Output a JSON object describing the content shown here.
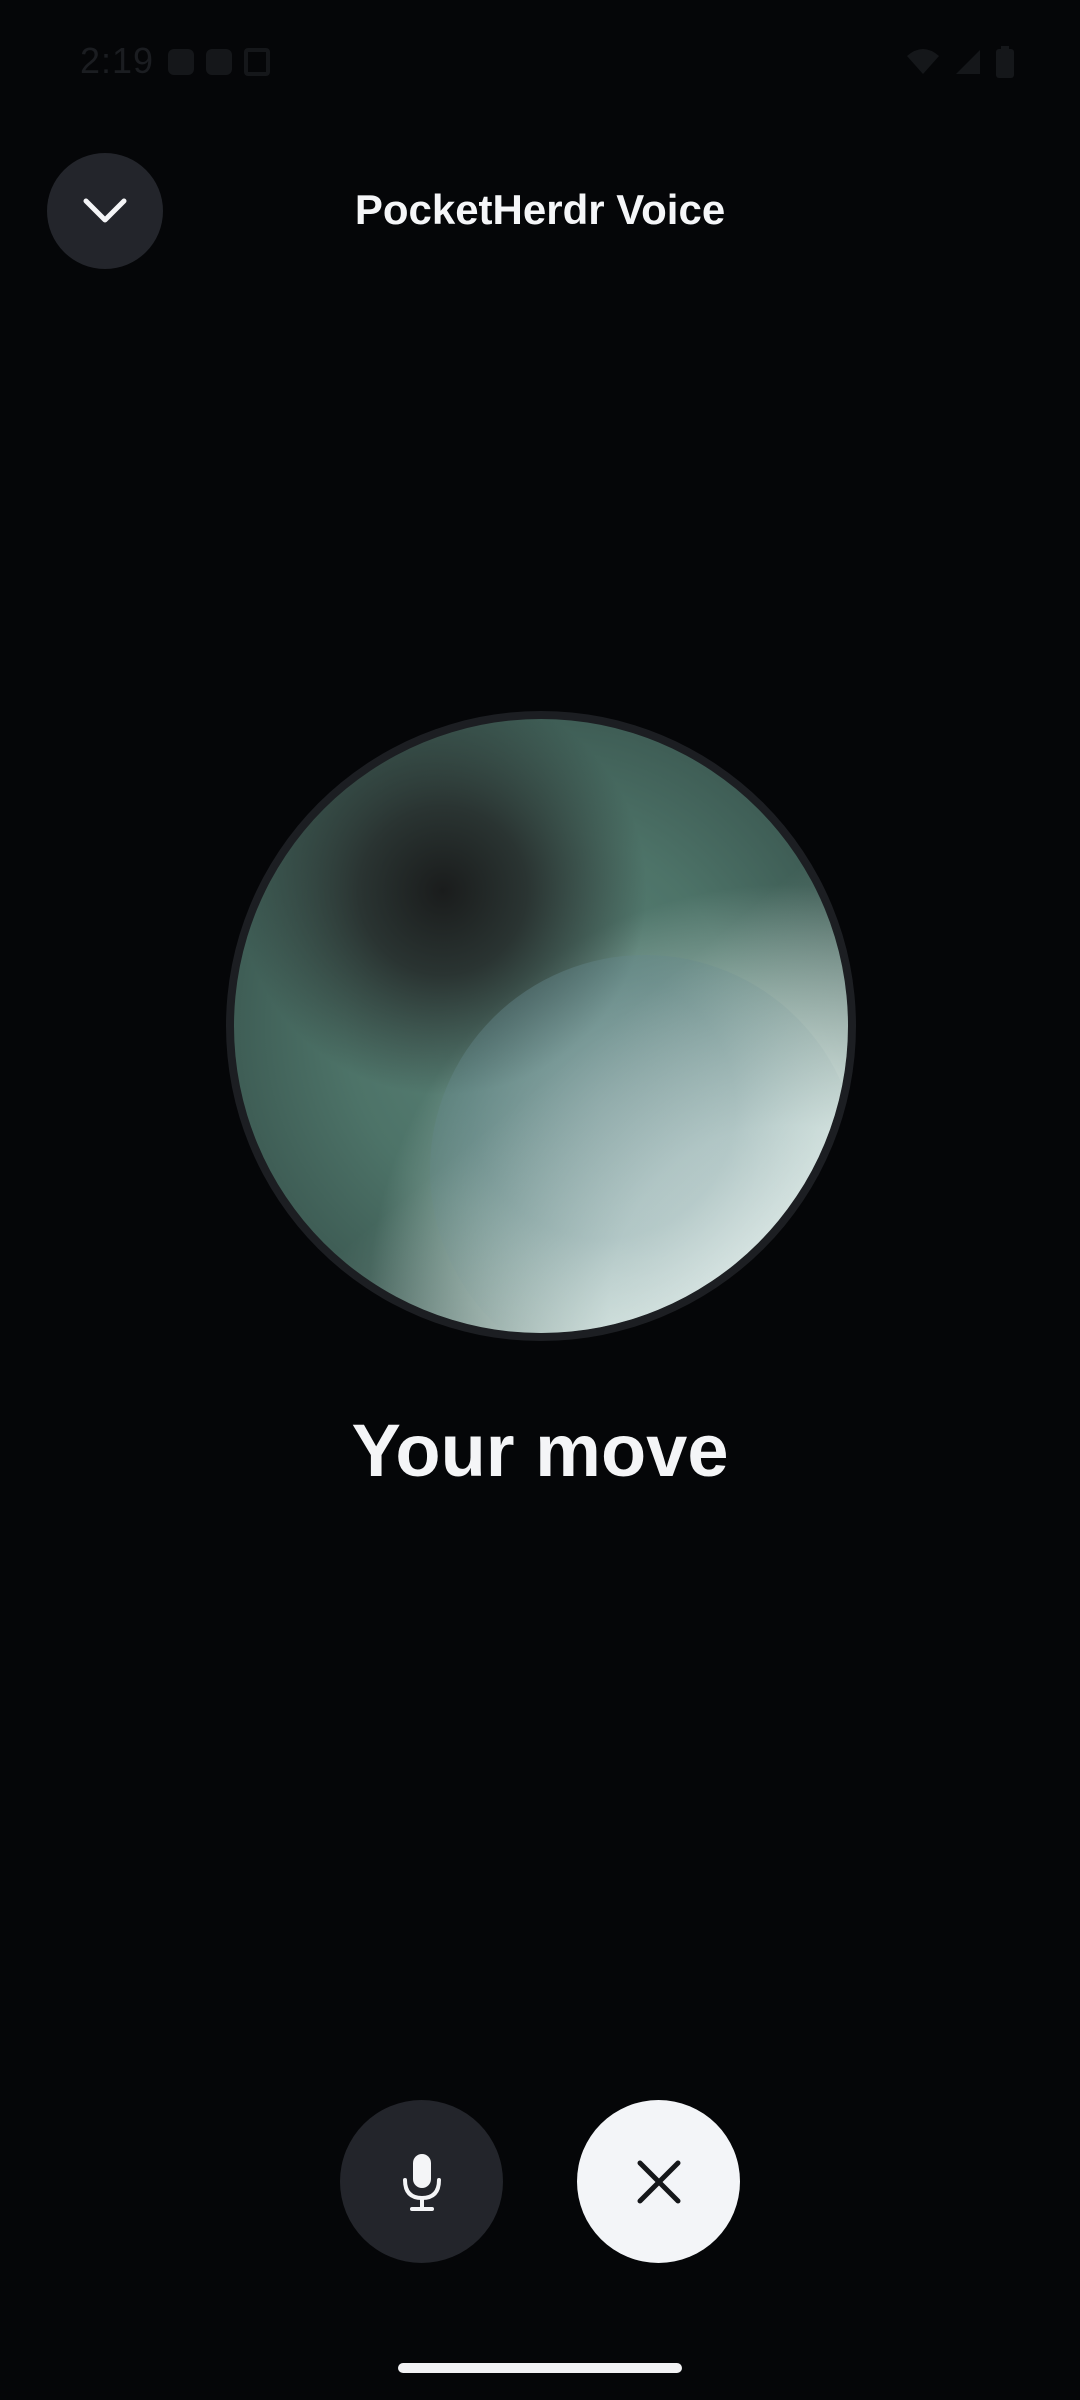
{
  "status_bar": {
    "time": "2:19",
    "icons": [
      "notification-icon",
      "screenshot-icon",
      "wifi-icon",
      "signal-icon",
      "battery-icon"
    ]
  },
  "header": {
    "title": "PocketHerdr Voice",
    "collapse_icon": "chevron-down-icon"
  },
  "orb": {
    "colors": {
      "base": "#4d7368",
      "dark": "#1a1c1c",
      "highlight": "#e8f1ee",
      "inner": "#6f9095"
    }
  },
  "main": {
    "status_text": "Your move"
  },
  "controls": {
    "mic_icon": "microphone-icon",
    "close_icon": "close-icon"
  },
  "colors": {
    "background": "#050608",
    "button_dark": "#23252b",
    "button_light": "#f3f5f8",
    "text": "#f4f5f7"
  }
}
